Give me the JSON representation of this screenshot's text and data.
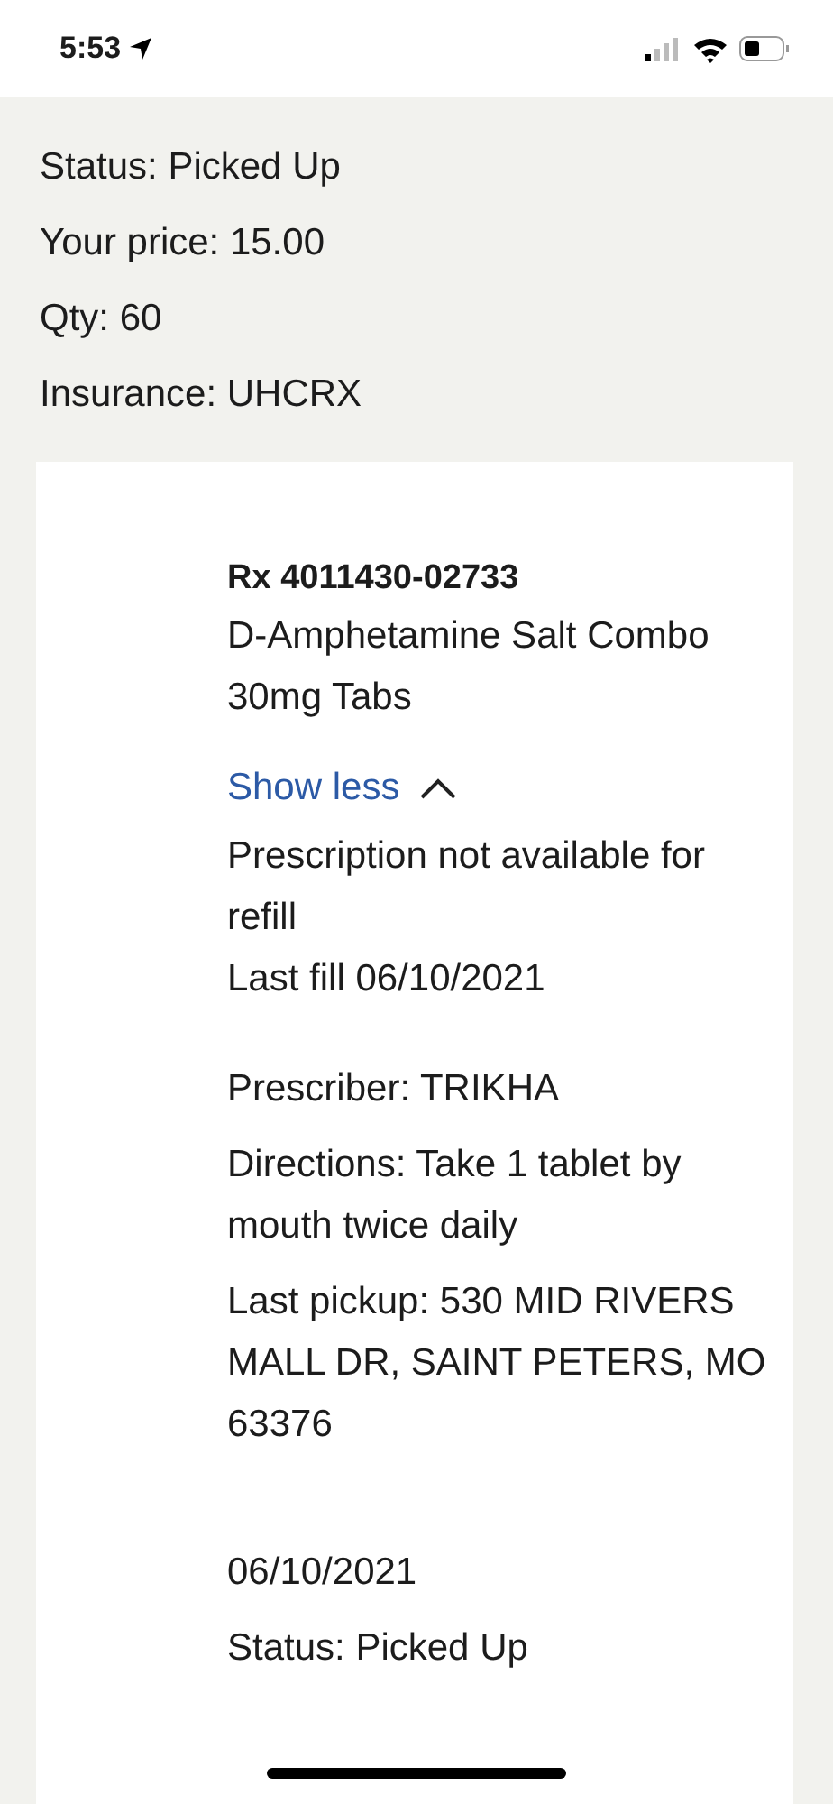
{
  "status_bar": {
    "time": "5:53"
  },
  "previous_fill": {
    "lines": [
      "Status: Picked Up",
      "Your price: 15.00",
      "Qty: 60",
      "Insurance: UHCRX"
    ]
  },
  "prescription": {
    "rx_number": "Rx 4011430-02733",
    "drug": "D-Amphetamine Salt Combo 30mg Tabs",
    "toggle": {
      "label": "Show less",
      "expanded": true
    },
    "availability": "Prescription not available for refill",
    "last_fill": "Last fill 06/10/2021",
    "details": [
      "Prescriber: TRIKHA",
      "Directions: Take 1 tablet by mouth twice daily",
      "Last pickup: 530 MID RIVERS MALL DR, SAINT PETERS, MO 63376"
    ],
    "fill": {
      "date": "06/10/2021",
      "status": "Status: Picked Up"
    }
  }
}
